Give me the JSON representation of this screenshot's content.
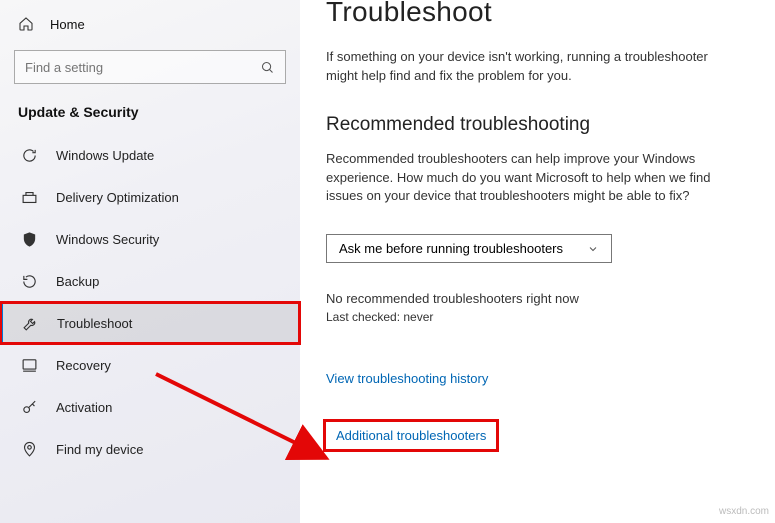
{
  "sidebar": {
    "home_label": "Home",
    "search_placeholder": "Find a setting",
    "section_title": "Update & Security",
    "items": [
      {
        "label": "Windows Update"
      },
      {
        "label": "Delivery Optimization"
      },
      {
        "label": "Windows Security"
      },
      {
        "label": "Backup"
      },
      {
        "label": "Troubleshoot"
      },
      {
        "label": "Recovery"
      },
      {
        "label": "Activation"
      },
      {
        "label": "Find my device"
      }
    ]
  },
  "main": {
    "title": "Troubleshoot",
    "intro": "If something on your device isn't working, running a troubleshooter might help find and fix the problem for you.",
    "recommended_heading": "Recommended troubleshooting",
    "recommended_body": "Recommended troubleshooters can help improve your Windows experience. How much do you want Microsoft to help when we find issues on your device that troubleshooters might be able to fix?",
    "dropdown_value": "Ask me before running troubleshooters",
    "no_recommended": "No recommended troubleshooters right now",
    "last_checked": "Last checked: never",
    "link_history": "View troubleshooting history",
    "link_additional": "Additional troubleshooters"
  },
  "watermark": "wsxdn.com"
}
